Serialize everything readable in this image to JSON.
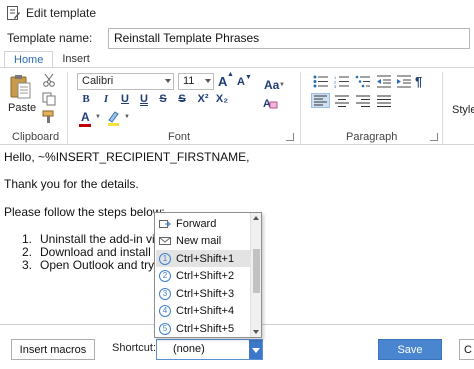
{
  "window": {
    "title": "Edit template"
  },
  "template": {
    "name_label": "Template name:",
    "name_value": "Reinstall Template Phrases"
  },
  "ribbon": {
    "tabs": [
      "Home",
      "Insert"
    ],
    "clipboard": {
      "paste_label": "Paste",
      "group_label": "Clipboard"
    },
    "font": {
      "family": "Calibri",
      "size": "11",
      "grow_label": "A",
      "shrink_label": "A",
      "change_case_label": "Aa",
      "bold": "B",
      "italic": "I",
      "underline": "U",
      "double_underline": "U",
      "strikethrough": "S",
      "double_strikethrough": "S",
      "superscript": "X²",
      "subscript": "X₂",
      "font_color_label": "A",
      "group_label": "Font"
    },
    "paragraph": {
      "group_label": "Paragraph"
    },
    "styles": {
      "label": "Styles"
    }
  },
  "editor": {
    "greeting": "Hello, ~%INSERT_RECIPIENT_FIRSTNAME,",
    "thanks": "Thank you for the details.",
    "steps_intro": "Please follow the steps below:",
    "list": [
      {
        "num": "1.",
        "text": "Uninstall the add-in via C"
      },
      {
        "num": "2.",
        "text": "Download and install the"
      },
      {
        "num": "3.",
        "text": "Open Outlook and try to"
      }
    ]
  },
  "shortcut_dropdown": {
    "items": [
      {
        "label": "Forward",
        "icon": "forward-icon"
      },
      {
        "label": "New mail",
        "icon": "new-mail-icon"
      },
      {
        "label": "Ctrl+Shift+1",
        "num": "1"
      },
      {
        "label": "Ctrl+Shift+2",
        "num": "2"
      },
      {
        "label": "Ctrl+Shift+3",
        "num": "3"
      },
      {
        "label": "Ctrl+Shift+4",
        "num": "4"
      },
      {
        "label": "Ctrl+Shift+5",
        "num": "5"
      }
    ],
    "selected_index": 2
  },
  "footer": {
    "insert_macros": "Insert macros",
    "shortcut_label": "Shortcut:",
    "shortcut_value": "(none)",
    "save": "Save",
    "cancel": "C"
  },
  "colors": {
    "accent": "#3c78c7",
    "ribbon_text": "#1f3e78",
    "font_color_bar": "#c00000"
  }
}
